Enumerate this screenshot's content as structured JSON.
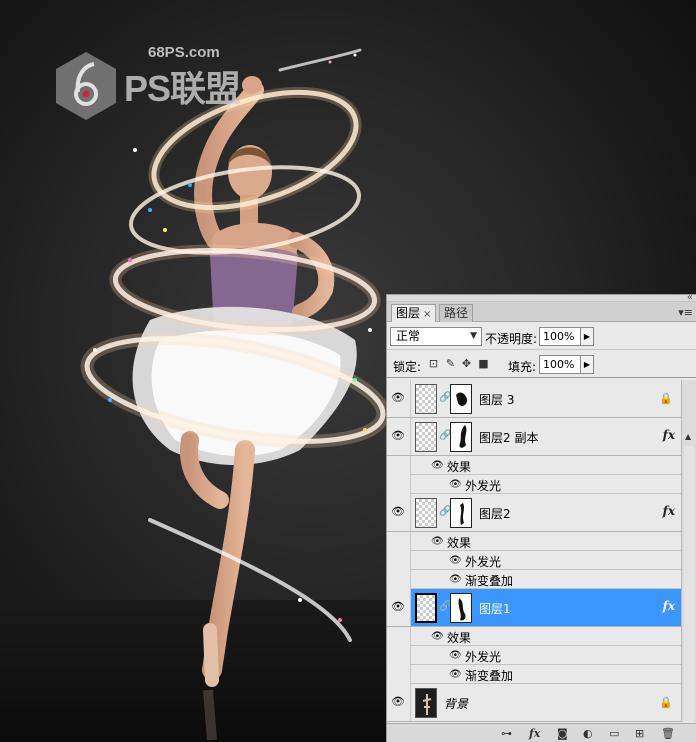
{
  "watermark": {
    "site": "68PS.com",
    "brand": "PS联盟"
  },
  "panel": {
    "tabs": [
      {
        "label": "图层",
        "active": true
      },
      {
        "label": "路径",
        "active": false
      }
    ],
    "blend_mode": "正常",
    "opacity_label": "不透明度:",
    "opacity_value": "100%",
    "lock_label": "锁定:",
    "fill_label": "填充:",
    "fill_value": "100%",
    "layers": [
      {
        "name": "图层 3",
        "fx": false,
        "locked": true,
        "selected": false
      },
      {
        "name": "图层2 副本",
        "fx": true,
        "selected": false,
        "effects_label": "效果",
        "effects": [
          "外发光"
        ]
      },
      {
        "name": "图层2",
        "fx": true,
        "selected": false,
        "effects_label": "效果",
        "effects": [
          "外发光",
          "渐变叠加"
        ]
      },
      {
        "name": "图层1",
        "fx": true,
        "selected": true,
        "effects_label": "效果",
        "effects": [
          "外发光",
          "渐变叠加"
        ]
      },
      {
        "name": "背景",
        "fx": false,
        "locked": true,
        "selected": false
      }
    ],
    "fx_label": "fx",
    "selection_color": "#3b96ff"
  }
}
